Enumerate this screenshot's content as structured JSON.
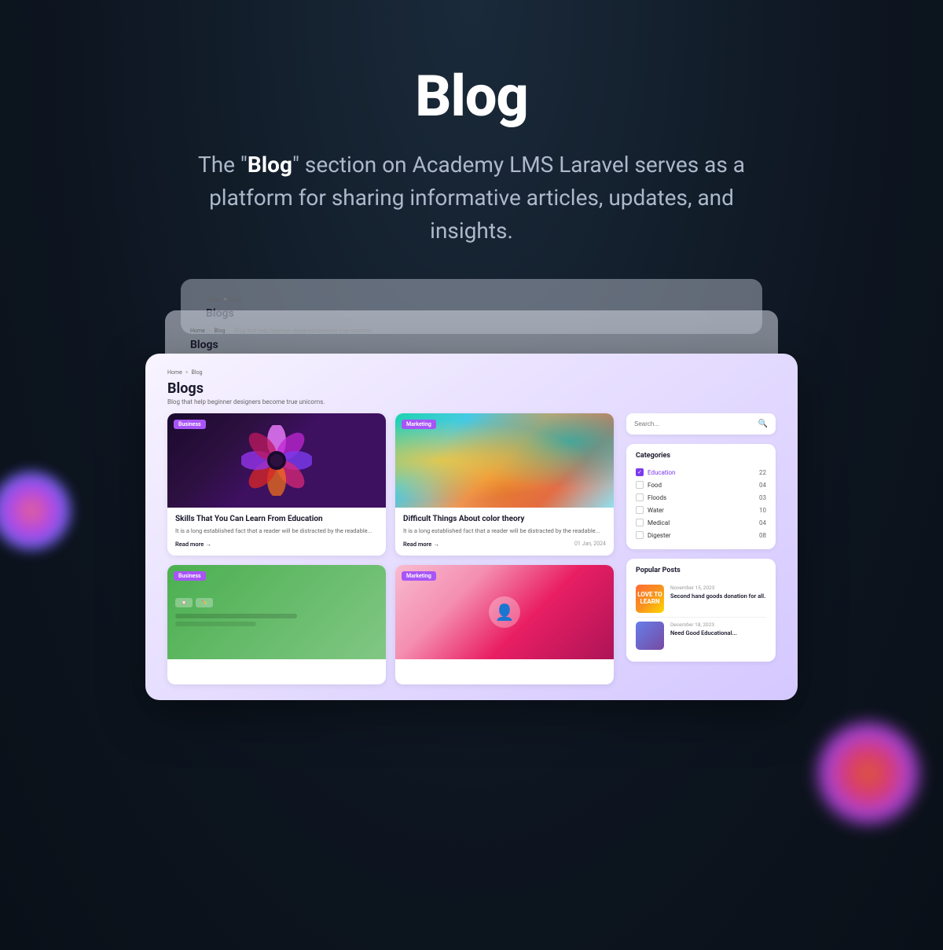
{
  "page": {
    "title": "Blog",
    "description_prefix": "The \"",
    "description_brand": "Blog",
    "description_suffix": "\" section on Academy LMS Laravel serves as a platform for sharing informative articles, updates, and insights."
  },
  "breadcrumb": {
    "home": "Home",
    "separator": ">",
    "current": "Blog"
  },
  "blogs_section": {
    "title": "Blogs",
    "subtitle": "Blog that help beginner designers become true unicorns."
  },
  "cards": [
    {
      "badge": "Business",
      "title": "Skills That You Can Learn From Education",
      "excerpt": "It is a long established fact that a reader will be distracted by the readable...",
      "read_more": "Read more",
      "arrow": "→",
      "date": "",
      "image_type": "flower"
    },
    {
      "badge": "Marketing",
      "title": "Difficult Things About color theory",
      "excerpt": "It is a long established fact that a reader will be distracted by the readable...",
      "read_more": "Read more",
      "arrow": "→",
      "date": "01 Jan, 2024",
      "image_type": "marble"
    },
    {
      "badge": "Business",
      "title": "",
      "excerpt": "",
      "read_more": "",
      "arrow": "",
      "date": "",
      "image_type": "green"
    },
    {
      "badge": "Marketing",
      "title": "",
      "excerpt": "",
      "read_more": "",
      "arrow": "",
      "date": "",
      "image_type": "pink"
    }
  ],
  "sidebar": {
    "search_placeholder": "Search...",
    "categories_title": "Categories",
    "categories": [
      {
        "name": "Education",
        "count": "22",
        "checked": true
      },
      {
        "name": "Food",
        "count": "04",
        "checked": false
      },
      {
        "name": "Floods",
        "count": "03",
        "checked": false
      },
      {
        "name": "Water",
        "count": "10",
        "checked": false
      },
      {
        "name": "Medical",
        "count": "04",
        "checked": false
      },
      {
        "name": "Digester",
        "count": "08",
        "checked": false
      }
    ],
    "popular_posts_title": "Popular Posts",
    "popular_posts": [
      {
        "date": "November 15, 2023",
        "title": "Second hand goods donation for all.",
        "thumb_type": "orange"
      },
      {
        "date": "December 18, 2023",
        "title": "Need Good Educational...",
        "thumb_type": "purple"
      }
    ]
  },
  "back_mockup1": {
    "breadcrumb_home": "Home",
    "breadcrumb_sep": ">",
    "breadcrumb_blog": "Blog",
    "title": "Blogs"
  },
  "back_mockup2": {
    "breadcrumb_home": "Home",
    "breadcrumb_sep": ">",
    "breadcrumb_blog": "Blog",
    "subtitle": "Blog that help beginner designers become true unicorns.",
    "title": "Blogs"
  }
}
